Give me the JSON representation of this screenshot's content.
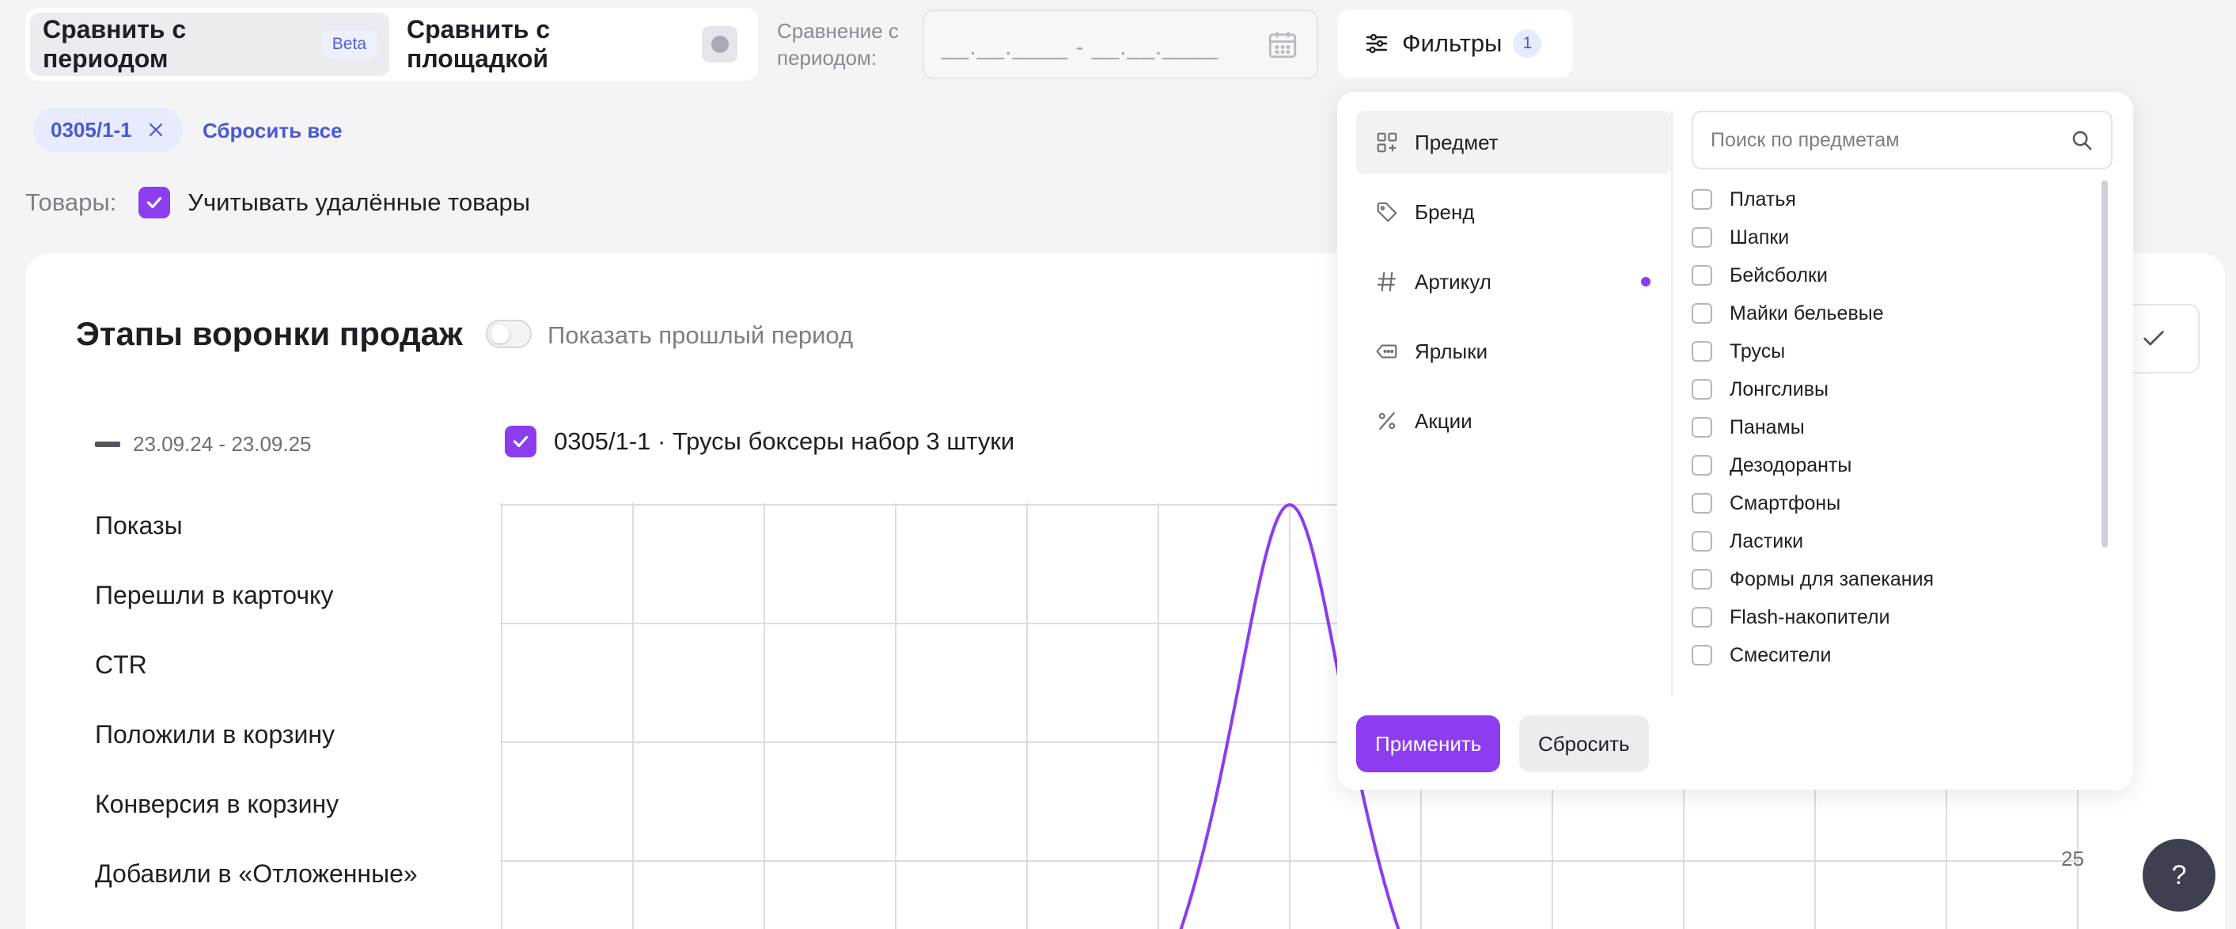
{
  "compare": {
    "period_tab": "Сравнить с периодом",
    "beta": "Beta",
    "platform_tab": "Сравнить с площадкой",
    "period_label": "Сравнение с периодом:",
    "date_mask": "__.__.____ - __.__.____"
  },
  "filters_button": {
    "label": "Фильтры",
    "count": "1"
  },
  "active_filters": {
    "chip": "0305/1-1",
    "reset_all": "Сбросить все"
  },
  "goods": {
    "label": "Товары:",
    "checkbox_label": "Учитывать удалённые товары",
    "checked": true
  },
  "funnel": {
    "title": "Этапы воронки продаж",
    "show_past_label": "Показать прошлый период",
    "period": "23.09.24 - 23.09.25",
    "series_label": "0305/1-1 · Трусы боксеры набор 3 штуки",
    "metrics": [
      "Показы",
      "Перешли в карточку",
      "CTR",
      "Положили в корзину",
      "Конверсия в корзину",
      "Добавили в «Отложенные»"
    ],
    "axis_value": "25",
    "line_color": "#8c3df0"
  },
  "dropdown": {
    "categories": [
      {
        "label": "Предмет",
        "icon": "category-grid-icon",
        "active": true
      },
      {
        "label": "Бренд",
        "icon": "tag-icon"
      },
      {
        "label": "Артикул",
        "icon": "hash-icon",
        "has_selection": true
      },
      {
        "label": "Ярлыки",
        "icon": "label-icon"
      },
      {
        "label": "Акции",
        "icon": "percent-icon"
      }
    ],
    "search_placeholder": "Поиск по предметам",
    "options": [
      "Платья",
      "Шапки",
      "Бейсболки",
      "Майки бельевые",
      "Трусы",
      "Лонгсливы",
      "Панамы",
      "Дезодоранты",
      "Смартфоны",
      "Ластики",
      "Формы для запекания",
      "Flash-накопители",
      "Смесители"
    ],
    "apply": "Применить",
    "reset": "Сбросить"
  },
  "help": "?",
  "colors": {
    "accent": "#8c3df0",
    "link": "#4a58d6"
  }
}
